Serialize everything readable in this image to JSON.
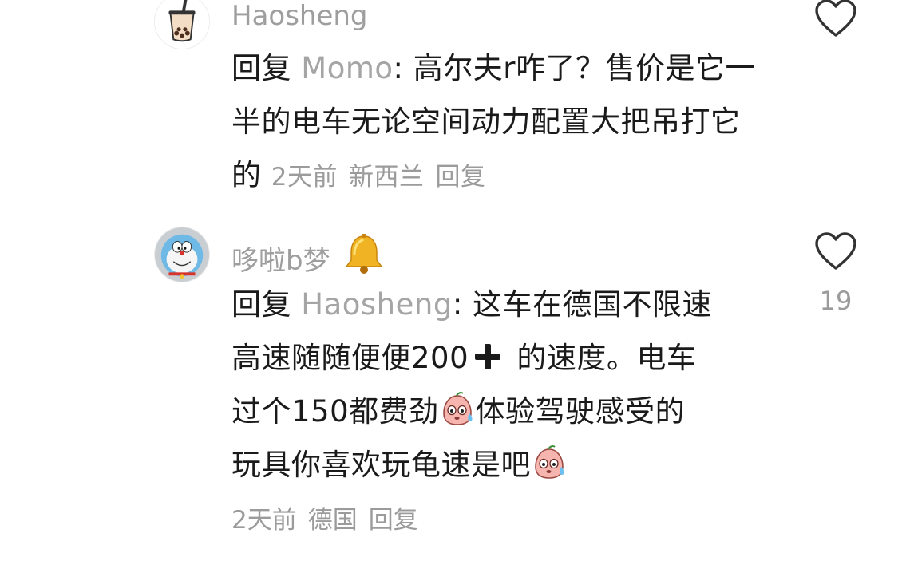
{
  "comments": [
    {
      "username": "Haosheng",
      "reply_prefix": "回复 ",
      "mention": "Momo",
      "text": ": 高尔夫r咋了？售价是它一半的电车无论空间动力配置大把吊打它的",
      "time": "2天前",
      "location": "新西兰",
      "reply_label": "回复",
      "avatar_icon": "bubble-tea-icon"
    },
    {
      "username": "哆啦b梦",
      "badge_icon": "bell-emoji",
      "reply_prefix": "回复 ",
      "mention": "Haosheng",
      "text_line1": ": 这车在德国不限速",
      "text_line2a": "高速随随便便200",
      "text_line2b": " 的速度。电车",
      "text_line3a": "过个150都费劲",
      "text_line3b": "体验驾驶感受的",
      "text_line4a": "玩具你喜欢玩龟速是吧",
      "time": "2天前",
      "location": "德国",
      "reply_label": "回复",
      "likes": "19",
      "avatar_icon": "doraemon-avatar-icon"
    }
  ],
  "colors": {
    "text": "#1a1a1a",
    "muted": "#9b9b9b",
    "mention": "#a5a5a5"
  }
}
